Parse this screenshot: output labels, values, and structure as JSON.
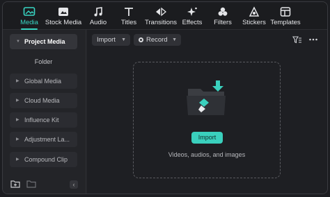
{
  "toolbar": {
    "tabs": [
      {
        "label": "Media",
        "icon": "media-icon",
        "active": true
      },
      {
        "label": "Stock Media",
        "icon": "stock-media-icon"
      },
      {
        "label": "Audio",
        "icon": "music-note-icon"
      },
      {
        "label": "Titles",
        "icon": "titles-t-icon"
      },
      {
        "label": "Transitions",
        "icon": "transitions-icon"
      },
      {
        "label": "Effects",
        "icon": "effects-sparkle-icon"
      },
      {
        "label": "Filters",
        "icon": "filters-icon"
      },
      {
        "label": "Stickers",
        "icon": "stickers-icon"
      },
      {
        "label": "Templates",
        "icon": "templates-icon"
      }
    ]
  },
  "sidebar": {
    "items": [
      {
        "label": "Project Media",
        "expanded": true
      },
      {
        "label": "Folder"
      },
      {
        "label": "Global Media"
      },
      {
        "label": "Cloud Media"
      },
      {
        "label": "Influence Kit"
      },
      {
        "label": "Adjustment La..."
      },
      {
        "label": "Compound Clip"
      }
    ],
    "bottom_icons": [
      "new-folder-icon",
      "folder-icon",
      "collapse-left-icon"
    ]
  },
  "main": {
    "import_label": "Import",
    "record_label": "Record",
    "dropzone": {
      "button_label": "Import",
      "hint": "Videos, audios, and images"
    }
  },
  "colors": {
    "accent": "#38d6c4",
    "background": "#1e1f23",
    "panel": "#232428"
  }
}
